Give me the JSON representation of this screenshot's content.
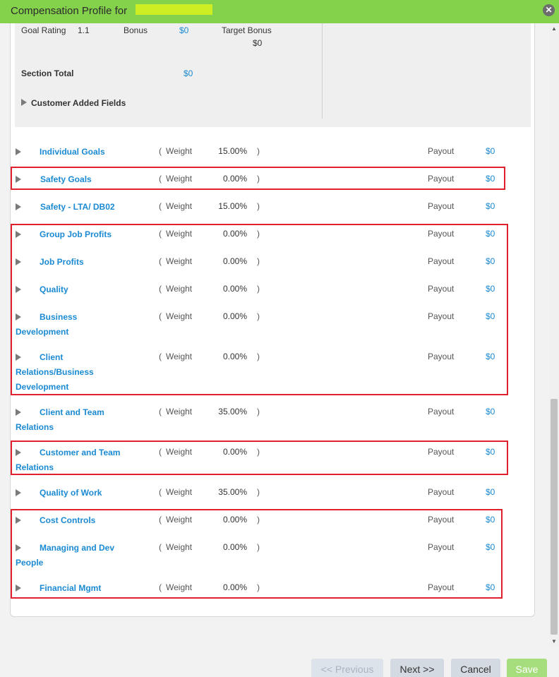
{
  "header": {
    "title": "Compensation Profile for",
    "close_symbol": "✕"
  },
  "summary": {
    "goal_rating_label": "Goal Rating",
    "goal_rating_value": "1.1",
    "bonus_label": "Bonus",
    "bonus_value": "$0",
    "target_bonus_label": "Target Bonus",
    "target_bonus_value": "$0",
    "section_total_label": "Section Total",
    "section_total_value": "$0",
    "customer_fields_label": "Customer Added Fields"
  },
  "labels": {
    "open_paren": "(",
    "weight": "Weight",
    "close_paren": ")",
    "payout": "Payout"
  },
  "goals": [
    {
      "name": "Individual Goals",
      "name_cont": "",
      "weight": "15.00%",
      "payout": "$0"
    },
    {
      "name": "Safety Goals",
      "name_cont": "",
      "weight": "0.00%",
      "payout": "$0"
    },
    {
      "name": "Safety - LTA/ DB02",
      "name_cont": "",
      "weight": "15.00%",
      "payout": "$0"
    },
    {
      "name": "Group Job Profits",
      "name_cont": "",
      "weight": "0.00%",
      "payout": "$0"
    },
    {
      "name": "Job Profits",
      "name_cont": "",
      "weight": "0.00%",
      "payout": "$0"
    },
    {
      "name": "Quality",
      "name_cont": "",
      "weight": "0.00%",
      "payout": "$0"
    },
    {
      "name": "Business",
      "name_cont": "Development",
      "weight": "0.00%",
      "payout": "$0"
    },
    {
      "name": "Client",
      "name_cont": "Relations/Business",
      "name_cont2": "Development",
      "weight": "0.00%",
      "payout": "$0"
    },
    {
      "name": "Client and Team",
      "name_cont": "Relations",
      "weight": "35.00%",
      "payout": "$0"
    },
    {
      "name": "Customer and Team",
      "name_cont": "Relations",
      "weight": "0.00%",
      "payout": "$0"
    },
    {
      "name": "Quality of Work",
      "name_cont": "",
      "weight": "35.00%",
      "payout": "$0"
    },
    {
      "name": "Cost Controls",
      "name_cont": "",
      "weight": "0.00%",
      "payout": "$0"
    },
    {
      "name": "Managing and Dev",
      "name_cont": "People",
      "weight": "0.00%",
      "payout": "$0"
    },
    {
      "name": "Financial Mgmt",
      "name_cont": "",
      "weight": "0.00%",
      "payout": "$0"
    }
  ],
  "footer": {
    "previous": "<< Previous",
    "next": "Next >>",
    "cancel": "Cancel",
    "save": "Save"
  },
  "colors": {
    "header_bg": "#84d14c",
    "link": "#1b8ad3",
    "highlight": "#e0202c"
  }
}
